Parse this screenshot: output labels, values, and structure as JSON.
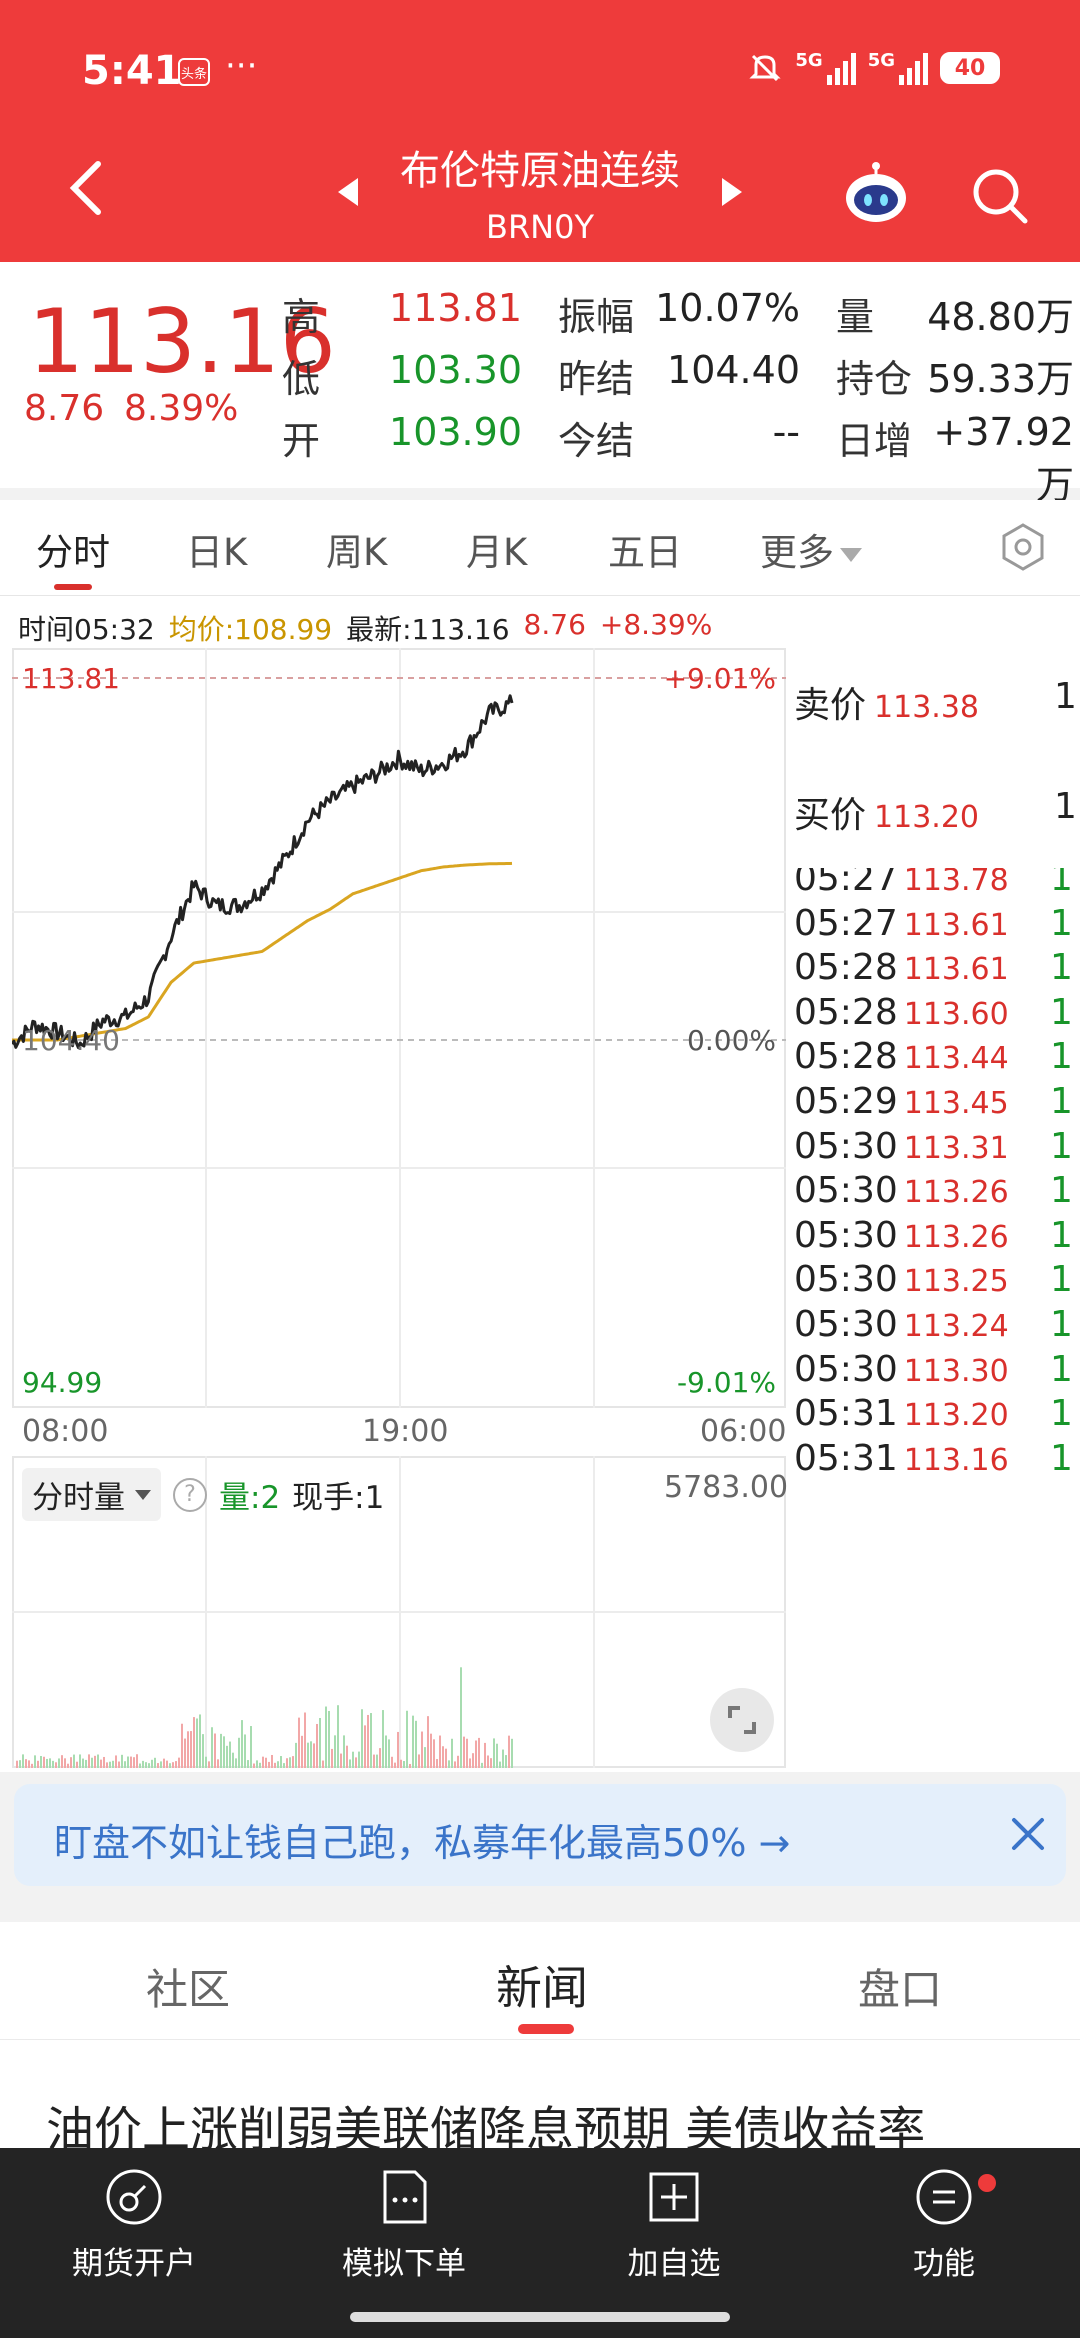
{
  "status": {
    "time": "5:41",
    "app_badge": "头条",
    "dots": "···",
    "net1": "5G",
    "net2": "5G",
    "battery": "40"
  },
  "header": {
    "title": "布伦特原油连续",
    "code": "BRN0Y"
  },
  "quote": {
    "price": "113.16",
    "change": "8.76",
    "change_pct": "8.39%",
    "high_label": "高",
    "high": "113.81",
    "low_label": "低",
    "low": "103.30",
    "open_label": "开",
    "open": "103.90",
    "amp_label": "振幅",
    "amp": "10.07%",
    "prev_label": "昨结",
    "prev": "104.40",
    "today_label": "今结",
    "today": "--",
    "vol_label": "量",
    "vol": "48.80万",
    "oi_label": "持仓",
    "oi": "59.33万",
    "daily_label": "日增",
    "daily": "+37.92万"
  },
  "tabs": [
    "分时",
    "日K",
    "周K",
    "月K",
    "五日",
    "更多"
  ],
  "info": {
    "time": "时间05:32",
    "avg": "均价:108.99",
    "latest": "最新:113.16",
    "chg": "8.76",
    "pct": "+8.39%"
  },
  "chart_labels": {
    "top_price": "113.81",
    "top_pct": "+9.01%",
    "mid_price": "104.40",
    "mid_pct": "0.00%",
    "bottom_price": "94.99",
    "bottom_pct": "-9.01%",
    "t0": "08:00",
    "t1": "19:00",
    "t2": "06:00"
  },
  "order": {
    "ask_label": "卖价",
    "ask": "113.38",
    "ask_q": "1",
    "bid_label": "买价",
    "bid": "113.20",
    "bid_q": "1"
  },
  "trades": [
    {
      "t": "05:27",
      "p": "113.78",
      "q": "1"
    },
    {
      "t": "05:27",
      "p": "113.61",
      "q": "1"
    },
    {
      "t": "05:28",
      "p": "113.61",
      "q": "1"
    },
    {
      "t": "05:28",
      "p": "113.60",
      "q": "1"
    },
    {
      "t": "05:28",
      "p": "113.44",
      "q": "1"
    },
    {
      "t": "05:29",
      "p": "113.45",
      "q": "1"
    },
    {
      "t": "05:30",
      "p": "113.31",
      "q": "1"
    },
    {
      "t": "05:30",
      "p": "113.26",
      "q": "1"
    },
    {
      "t": "05:30",
      "p": "113.26",
      "q": "1"
    },
    {
      "t": "05:30",
      "p": "113.25",
      "q": "1"
    },
    {
      "t": "05:30",
      "p": "113.24",
      "q": "1"
    },
    {
      "t": "05:30",
      "p": "113.30",
      "q": "1"
    },
    {
      "t": "05:31",
      "p": "113.20",
      "q": "1"
    },
    {
      "t": "05:31",
      "p": "113.16",
      "q": "1"
    }
  ],
  "volume": {
    "selector": "分时量",
    "help": "?",
    "qty": "量:2",
    "hand": "现手:1",
    "max": "5783.00"
  },
  "banner": {
    "text": "盯盘不如让钱自己跑，私募年化最高50% →"
  },
  "section_tabs": [
    "社区",
    "新闻",
    "盘口"
  ],
  "news": {
    "headline": "油价上涨削弱美联储降息预期 美债收益率"
  },
  "nav": [
    "期货开户",
    "模拟下单",
    "加自选",
    "功能"
  ],
  "colors": {
    "header": "#ee3b3b",
    "up": "#d9302c",
    "down": "#18952a",
    "avg": "#d9a521",
    "link": "#3a74c9"
  },
  "chart_data": {
    "type": "line",
    "xlabel": "",
    "ylabel": "",
    "x_ticks": [
      "08:00",
      "19:00",
      "06:00"
    ],
    "ylim": [
      94.99,
      113.81
    ],
    "y_ref": 104.4,
    "series": [
      {
        "x": [
          "08:00",
          "09:00",
          "10:00",
          "11:00",
          "12:00",
          "13:00",
          "14:00",
          "15:00",
          "16:00",
          "17:00",
          "18:00",
          "19:00",
          "20:00",
          "21:00",
          "22:00",
          "23:00",
          "00:00",
          "01:00",
          "02:00",
          "03:00",
          "04:00",
          "05:00",
          "05:32"
        ],
        "values": [
          104.3,
          104.8,
          104.6,
          104.3,
          104.9,
          105.0,
          105.5,
          107.1,
          108.4,
          107.9,
          107.9,
          108.3,
          109.1,
          110.1,
          110.6,
          111.0,
          111.3,
          111.7,
          111.4,
          111.6,
          112.0,
          112.9,
          113.16
        ]
      },
      {
        "x": [
          "08:00",
          "09:00",
          "10:00",
          "11:00",
          "12:00",
          "13:00",
          "14:00",
          "15:00",
          "16:00",
          "17:00",
          "18:00",
          "19:00",
          "20:00",
          "21:00",
          "22:00",
          "23:00",
          "00:00",
          "01:00",
          "02:00",
          "03:00",
          "04:00",
          "05:00",
          "05:32"
        ],
        "values": [
          104.4,
          104.4,
          104.4,
          104.5,
          104.6,
          104.7,
          105.0,
          105.9,
          106.4,
          106.5,
          106.6,
          106.7,
          107.1,
          107.5,
          107.8,
          108.2,
          108.4,
          108.6,
          108.8,
          108.9,
          108.95,
          108.98,
          108.99
        ]
      }
    ]
  }
}
